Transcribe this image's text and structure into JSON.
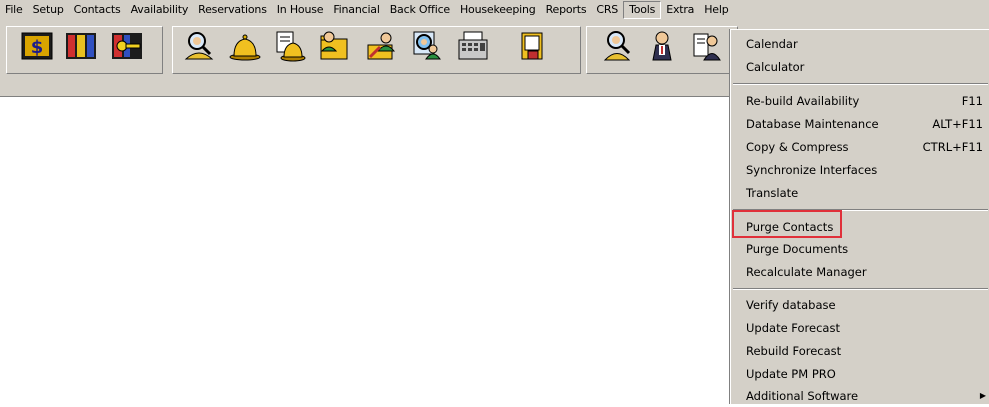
{
  "menubar": {
    "items": [
      {
        "label": "File"
      },
      {
        "label": "Setup"
      },
      {
        "label": "Contacts"
      },
      {
        "label": "Availability"
      },
      {
        "label": "Reservations"
      },
      {
        "label": "In House"
      },
      {
        "label": "Financial"
      },
      {
        "label": "Back Office"
      },
      {
        "label": "Housekeeping"
      },
      {
        "label": "Reports"
      },
      {
        "label": "CRS"
      },
      {
        "label": "Tools"
      },
      {
        "label": "Extra"
      },
      {
        "label": "Help"
      }
    ]
  },
  "toolbar": {
    "icons": [
      "dollar-icon",
      "books-icon",
      "key-icon",
      "search-person-icon",
      "bell-icon",
      "bell-document-icon",
      "folder-person-icon",
      "edit-person-icon",
      "magnifier-person-icon",
      "cash-register-icon",
      "notepad-icon",
      "person-icon",
      "person-standing-icon",
      "person-document-icon"
    ]
  },
  "tools_menu": {
    "items": [
      {
        "label": "Calendar",
        "shortcut": ""
      },
      {
        "label": "Calculator",
        "shortcut": ""
      },
      {
        "label": "Re-build Availability",
        "shortcut": "F11"
      },
      {
        "label": "Database Maintenance",
        "shortcut": "ALT+F11"
      },
      {
        "label": "Copy & Compress",
        "shortcut": "CTRL+F11"
      },
      {
        "label": "Synchronize Interfaces",
        "shortcut": ""
      },
      {
        "label": "Translate",
        "shortcut": ""
      },
      {
        "label": "Purge Contacts",
        "shortcut": ""
      },
      {
        "label": "Purge Documents",
        "shortcut": ""
      },
      {
        "label": "Recalculate Manager",
        "shortcut": ""
      },
      {
        "label": "Verify database",
        "shortcut": ""
      },
      {
        "label": "Update Forecast",
        "shortcut": ""
      },
      {
        "label": "Rebuild Forecast",
        "shortcut": ""
      },
      {
        "label": "Update PM PRO",
        "shortcut": ""
      },
      {
        "label": "Additional Software",
        "shortcut": ""
      }
    ],
    "highlighted_item": "Purge Contacts",
    "highlight_color": "#e0303a"
  },
  "colors": {
    "face": "#d4d0c8",
    "shadow": "#808080",
    "highlight": "#ffffff"
  }
}
